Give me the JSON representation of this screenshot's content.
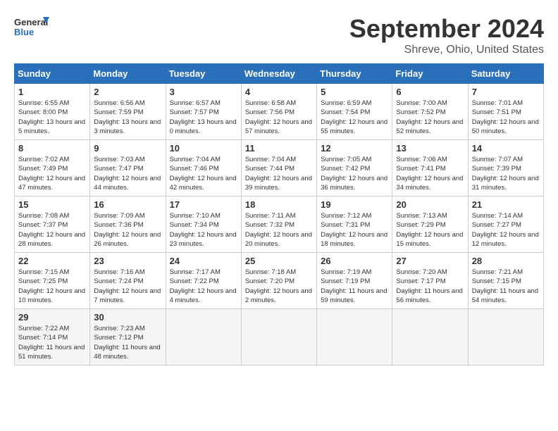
{
  "logo": {
    "line1": "General",
    "line2": "Blue"
  },
  "title": "September 2024",
  "location": "Shreve, Ohio, United States",
  "days_of_week": [
    "Sunday",
    "Monday",
    "Tuesday",
    "Wednesday",
    "Thursday",
    "Friday",
    "Saturday"
  ],
  "weeks": [
    [
      {
        "day": "1",
        "rise": "6:55 AM",
        "set": "8:00 PM",
        "hours": "13 hours and 5 minutes."
      },
      {
        "day": "2",
        "rise": "6:56 AM",
        "set": "7:59 PM",
        "hours": "13 hours and 3 minutes."
      },
      {
        "day": "3",
        "rise": "6:57 AM",
        "set": "7:57 PM",
        "hours": "13 hours and 0 minutes."
      },
      {
        "day": "4",
        "rise": "6:58 AM",
        "set": "7:56 PM",
        "hours": "12 hours and 57 minutes."
      },
      {
        "day": "5",
        "rise": "6:59 AM",
        "set": "7:54 PM",
        "hours": "12 hours and 55 minutes."
      },
      {
        "day": "6",
        "rise": "7:00 AM",
        "set": "7:52 PM",
        "hours": "12 hours and 52 minutes."
      },
      {
        "day": "7",
        "rise": "7:01 AM",
        "set": "7:51 PM",
        "hours": "12 hours and 50 minutes."
      }
    ],
    [
      {
        "day": "8",
        "rise": "7:02 AM",
        "set": "7:49 PM",
        "hours": "12 hours and 47 minutes."
      },
      {
        "day": "9",
        "rise": "7:03 AM",
        "set": "7:47 PM",
        "hours": "12 hours and 44 minutes."
      },
      {
        "day": "10",
        "rise": "7:04 AM",
        "set": "7:46 PM",
        "hours": "12 hours and 42 minutes."
      },
      {
        "day": "11",
        "rise": "7:04 AM",
        "set": "7:44 PM",
        "hours": "12 hours and 39 minutes."
      },
      {
        "day": "12",
        "rise": "7:05 AM",
        "set": "7:42 PM",
        "hours": "12 hours and 36 minutes."
      },
      {
        "day": "13",
        "rise": "7:06 AM",
        "set": "7:41 PM",
        "hours": "12 hours and 34 minutes."
      },
      {
        "day": "14",
        "rise": "7:07 AM",
        "set": "7:39 PM",
        "hours": "12 hours and 31 minutes."
      }
    ],
    [
      {
        "day": "15",
        "rise": "7:08 AM",
        "set": "7:37 PM",
        "hours": "12 hours and 28 minutes."
      },
      {
        "day": "16",
        "rise": "7:09 AM",
        "set": "7:36 PM",
        "hours": "12 hours and 26 minutes."
      },
      {
        "day": "17",
        "rise": "7:10 AM",
        "set": "7:34 PM",
        "hours": "12 hours and 23 minutes."
      },
      {
        "day": "18",
        "rise": "7:11 AM",
        "set": "7:32 PM",
        "hours": "12 hours and 20 minutes."
      },
      {
        "day": "19",
        "rise": "7:12 AM",
        "set": "7:31 PM",
        "hours": "12 hours and 18 minutes."
      },
      {
        "day": "20",
        "rise": "7:13 AM",
        "set": "7:29 PM",
        "hours": "12 hours and 15 minutes."
      },
      {
        "day": "21",
        "rise": "7:14 AM",
        "set": "7:27 PM",
        "hours": "12 hours and 12 minutes."
      }
    ],
    [
      {
        "day": "22",
        "rise": "7:15 AM",
        "set": "7:25 PM",
        "hours": "12 hours and 10 minutes."
      },
      {
        "day": "23",
        "rise": "7:16 AM",
        "set": "7:24 PM",
        "hours": "12 hours and 7 minutes."
      },
      {
        "day": "24",
        "rise": "7:17 AM",
        "set": "7:22 PM",
        "hours": "12 hours and 4 minutes."
      },
      {
        "day": "25",
        "rise": "7:18 AM",
        "set": "7:20 PM",
        "hours": "12 hours and 2 minutes."
      },
      {
        "day": "26",
        "rise": "7:19 AM",
        "set": "7:19 PM",
        "hours": "11 hours and 59 minutes."
      },
      {
        "day": "27",
        "rise": "7:20 AM",
        "set": "7:17 PM",
        "hours": "11 hours and 56 minutes."
      },
      {
        "day": "28",
        "rise": "7:21 AM",
        "set": "7:15 PM",
        "hours": "11 hours and 54 minutes."
      }
    ],
    [
      {
        "day": "29",
        "rise": "7:22 AM",
        "set": "7:14 PM",
        "hours": "11 hours and 51 minutes."
      },
      {
        "day": "30",
        "rise": "7:23 AM",
        "set": "7:12 PM",
        "hours": "11 hours and 48 minutes."
      },
      null,
      null,
      null,
      null,
      null
    ]
  ]
}
